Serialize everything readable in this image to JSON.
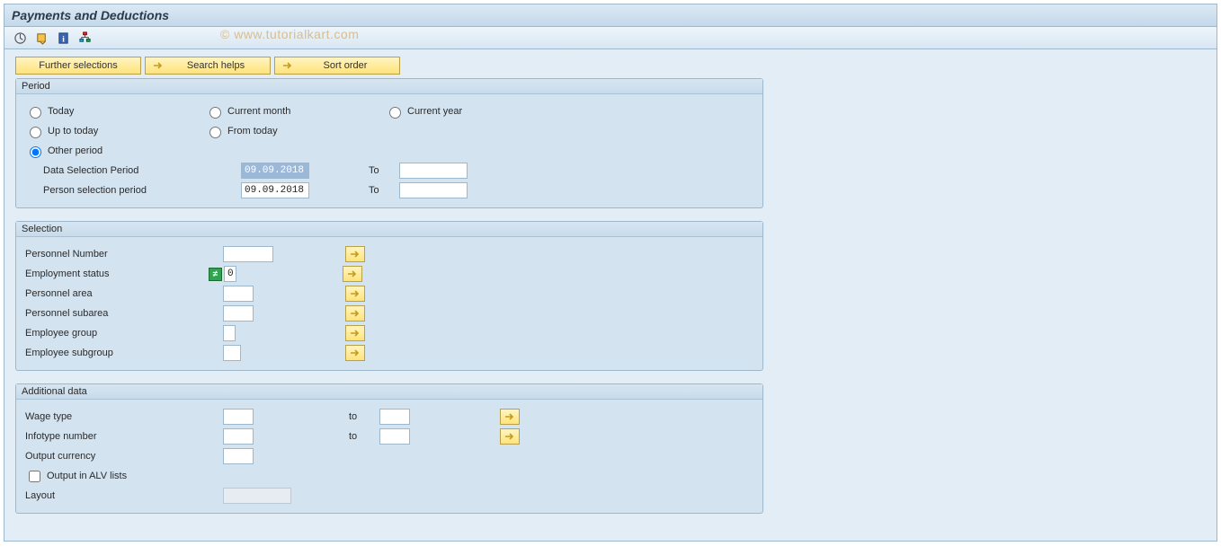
{
  "watermark": "© www.tutorialkart.com",
  "title": "Payments and Deductions",
  "topButtons": {
    "further": "Further selections",
    "search": "Search helps",
    "sort": "Sort order"
  },
  "period": {
    "legend": "Period",
    "today": "Today",
    "currentMonth": "Current month",
    "currentYear": "Current year",
    "upToToday": "Up to today",
    "fromToday": "From today",
    "otherPeriod": "Other period",
    "dataSelPeriod": "Data Selection Period",
    "dataSelFrom": "09.09.2018",
    "dataSelToLabel": "To",
    "dataSelTo": "",
    "personSelPeriod": "Person selection period",
    "personSelFrom": "09.09.2018",
    "personSelToLabel": "To",
    "personSelTo": "",
    "selected": "otherPeriod"
  },
  "selection": {
    "legend": "Selection",
    "personnelNumber": {
      "label": "Personnel Number",
      "value": ""
    },
    "employmentStatus": {
      "label": "Employment status",
      "value": "0"
    },
    "personnelArea": {
      "label": "Personnel area",
      "value": ""
    },
    "personnelSubarea": {
      "label": "Personnel subarea",
      "value": ""
    },
    "employeeGroup": {
      "label": "Employee group",
      "value": ""
    },
    "employeeSubgroup": {
      "label": "Employee subgroup",
      "value": ""
    }
  },
  "additional": {
    "legend": "Additional data",
    "wageType": {
      "label": "Wage type",
      "value": "",
      "toLabel": "to",
      "toValue": ""
    },
    "infotypeNumber": {
      "label": "Infotype number",
      "value": "",
      "toLabel": "to",
      "toValue": ""
    },
    "outputCurrency": {
      "label": "Output currency",
      "value": ""
    },
    "outputAlv": {
      "label": "Output in ALV lists",
      "checked": false
    },
    "layout": {
      "label": "Layout",
      "value": ""
    }
  }
}
